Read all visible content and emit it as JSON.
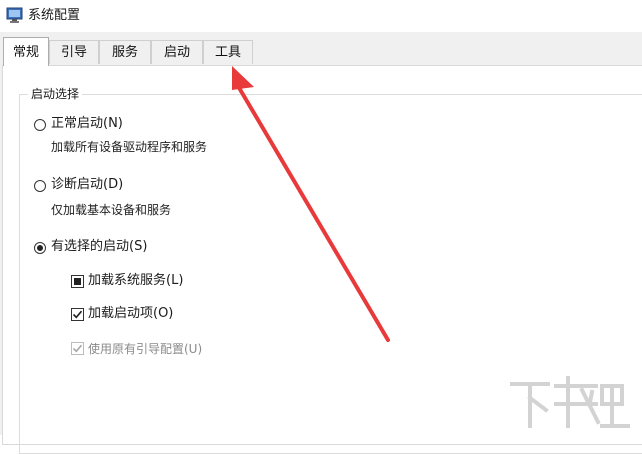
{
  "window": {
    "title": "系统配置",
    "icon": "msconfig-icon"
  },
  "tabs": [
    {
      "label": "常规",
      "active": true
    },
    {
      "label": "引导",
      "active": false
    },
    {
      "label": "服务",
      "active": false
    },
    {
      "label": "启动",
      "active": false
    },
    {
      "label": "工具",
      "active": false
    }
  ],
  "startup_selection": {
    "group_label": "启动选择",
    "options": [
      {
        "label": "正常启动(N)",
        "description": "加载所有设备驱动程序和服务",
        "selected": false
      },
      {
        "label": "诊断启动(D)",
        "description": "仅加载基本设备和服务",
        "selected": false
      },
      {
        "label": "有选择的启动(S)",
        "selected": true
      }
    ],
    "checkboxes": [
      {
        "label": "加载系统服务(L)",
        "state": "indeterminate",
        "enabled": true
      },
      {
        "label": "加载启动项(O)",
        "state": "checked",
        "enabled": true
      },
      {
        "label": "使用原有引导配置(U)",
        "state": "checked",
        "enabled": false
      }
    ]
  },
  "annotation": {
    "color": "#e8393b",
    "points_to": "工具"
  },
  "watermark": {
    "text": "下载吧"
  },
  "colors": {
    "tab_border": "#adadad",
    "panel_bg": "#ffffff",
    "chrome_bg": "#f0f0f0"
  }
}
